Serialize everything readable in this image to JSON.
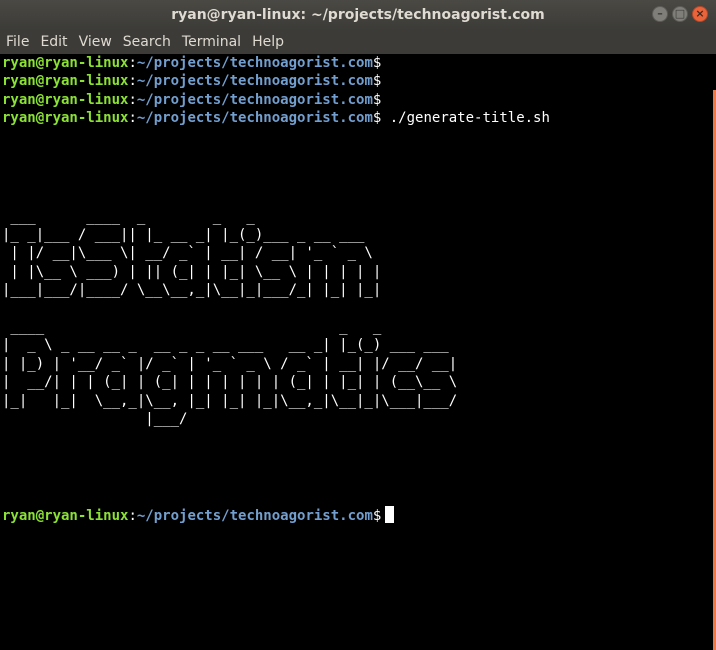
{
  "window": {
    "title": "ryan@ryan-linux: ~/projects/technoagorist.com",
    "controls": {
      "minimize": "–",
      "maximize": "□",
      "close": "×"
    }
  },
  "menu": [
    "File",
    "Edit",
    "View",
    "Search",
    "Terminal",
    "Help"
  ],
  "prompt": {
    "user": "ryan@ryan-linux",
    "colon": ":",
    "path": "~/projects/technoagorist.com",
    "symbol": "$"
  },
  "history": [
    {
      "command": ""
    },
    {
      "command": ""
    },
    {
      "command": ""
    },
    {
      "command": " ./generate-title.sh"
    }
  ],
  "output": {
    "ascii_art": " ___      ____  _        _   _\n|_ _|___ / ___|| |_ __ _| |_(_)___ _ __ ___\n | |/ __|\\___ \\| __/ _` | __| / __| '_ ` _ \\\n | |\\__ \\ ___) | || (_| | |_| \\__ \\ | | | | |\n|___|___/|____/ \\__\\__,_|\\__|_|___/_| |_| |_|\n\n ____                                   _   _\n|  _ \\ _ __ __ _  __ _ _ __ ___   __ _| |_(_) ___ ___\n| |_) | '__/ _` |/ _` | '_ ` _ \\ / _` | __| |/ __/ __|\n|  __/| | | (_| | (_| | | | | | | (_| | |_| | (__\\__ \\\n|_|   |_|  \\__,_|\\__, |_| |_| |_|\\__,_|\\__|_|\\___|___/\n                 |___/"
  },
  "colors": {
    "user": "#8ae234",
    "path": "#729fcf",
    "background": "#000000",
    "chrome": "#3c3b37",
    "accent": "#e9633b"
  }
}
